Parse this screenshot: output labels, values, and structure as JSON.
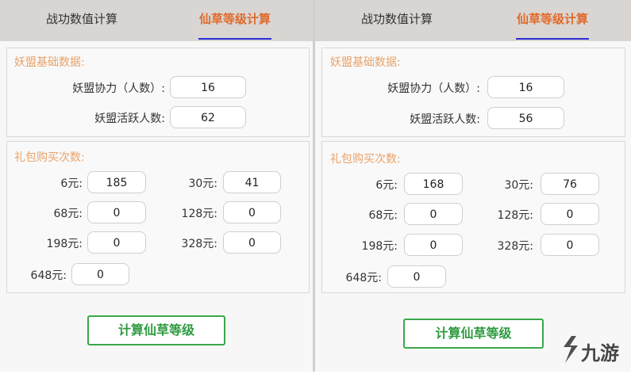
{
  "tabs": {
    "battle": "战功数值计算",
    "herb": "仙草等级计算"
  },
  "base_section": {
    "title": "妖盟基础数据:",
    "assist_label": "妖盟协力（人数）:",
    "active_label": "妖盟活跃人数:"
  },
  "gift_section": {
    "title": "礼包购买次数:",
    "labels": {
      "p6": "6元:",
      "p30": "30元:",
      "p68": "68元:",
      "p128": "128元:",
      "p198": "198元:",
      "p328": "328元:",
      "p648": "648元:"
    }
  },
  "calc_button": "计算仙草等级",
  "left": {
    "assist": "16",
    "active": "62",
    "gift": {
      "p6": "185",
      "p30": "41",
      "p68": "0",
      "p128": "0",
      "p198": "0",
      "p328": "0",
      "p648": "0"
    }
  },
  "right": {
    "assist": "16",
    "active": "56",
    "gift": {
      "p6": "168",
      "p30": "76",
      "p68": "0",
      "p128": "0",
      "p198": "0",
      "p328": "0",
      "p648": "0"
    }
  },
  "watermark": "九游",
  "colors": {
    "accent": "#e06a2a",
    "tab_underline": "#2d2dd6",
    "button": "#2e9a40",
    "legend": "#e9a26a"
  }
}
